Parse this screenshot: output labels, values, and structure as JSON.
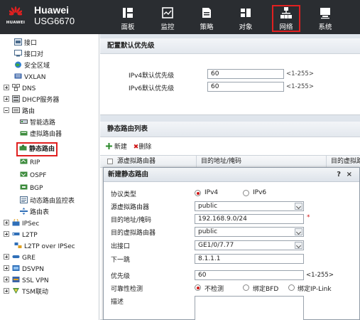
{
  "brand": {
    "name": "Huawei",
    "model": "USG6670",
    "logo_text": "HUAWEI",
    "logo_color": "#e02020"
  },
  "nav": [
    {
      "label": "面板",
      "icon": "dashboard-icon"
    },
    {
      "label": "监控",
      "icon": "monitor-icon"
    },
    {
      "label": "策略",
      "icon": "policy-icon"
    },
    {
      "label": "对象",
      "icon": "object-icon"
    },
    {
      "label": "网络",
      "icon": "network-icon",
      "active": true
    },
    {
      "label": "系统",
      "icon": "system-icon"
    }
  ],
  "sidebar": {
    "items": [
      {
        "label": "接口"
      },
      {
        "label": "接口对"
      },
      {
        "label": "安全区域"
      },
      {
        "label": "VXLAN"
      },
      {
        "label": "DNS"
      },
      {
        "label": "DHCP服务器"
      },
      {
        "label": "路由"
      },
      {
        "label": "智能选路"
      },
      {
        "label": "虚拟路由器"
      },
      {
        "label": "静态路由",
        "selected": true
      },
      {
        "label": "RIP"
      },
      {
        "label": "OSPF"
      },
      {
        "label": "BGP"
      },
      {
        "label": "动态路由监控表"
      },
      {
        "label": "路由表"
      },
      {
        "label": "IPSec"
      },
      {
        "label": "L2TP"
      },
      {
        "label": "L2TP over IPSec"
      },
      {
        "label": "GRE"
      },
      {
        "label": "DSVPN"
      },
      {
        "label": "SSL VPN"
      },
      {
        "label": "TSM联动"
      }
    ]
  },
  "priority_panel": {
    "title": "配置默认优先级",
    "ipv4_label": "IPv4默认优先级",
    "ipv4_value": "60",
    "ipv4_hint": "<1-255>",
    "ipv6_label": "IPv6默认优先级",
    "ipv6_value": "60",
    "ipv6_hint": "<1-255>"
  },
  "route_list": {
    "title": "静态路由列表",
    "new_label": "新建",
    "delete_label": "删除",
    "columns": [
      "源虚拟路由器",
      "目的地址/掩码",
      "目的虚拟路"
    ]
  },
  "dialog": {
    "title": "新建静态路由",
    "help": "?",
    "close": "×",
    "protocol_label": "协议类型",
    "protocol_options": [
      "IPv4",
      "IPv6"
    ],
    "protocol_selected": "IPv4",
    "src_vr_label": "源虚拟路由器",
    "src_vr_value": "public",
    "dest_label": "目的地址/掩码",
    "dest_value": "192.168.9.0/24",
    "required_mark": "*",
    "dest_vr_label": "目的虚拟路由器",
    "dest_vr_value": "public",
    "out_if_label": "出接口",
    "out_if_value": "GE1/0/7.77",
    "next_hop_label": "下一跳",
    "next_hop_value": "8.1.1.1",
    "priority_label": "优先级",
    "priority_value": "60",
    "priority_hint": "<1-255>",
    "reach_label": "可靠性检测",
    "reach_options": [
      "不检测",
      "绑定BFD",
      "绑定IP-Link"
    ],
    "reach_selected": "不检测",
    "desc_label": "描述",
    "desc_value": ""
  }
}
